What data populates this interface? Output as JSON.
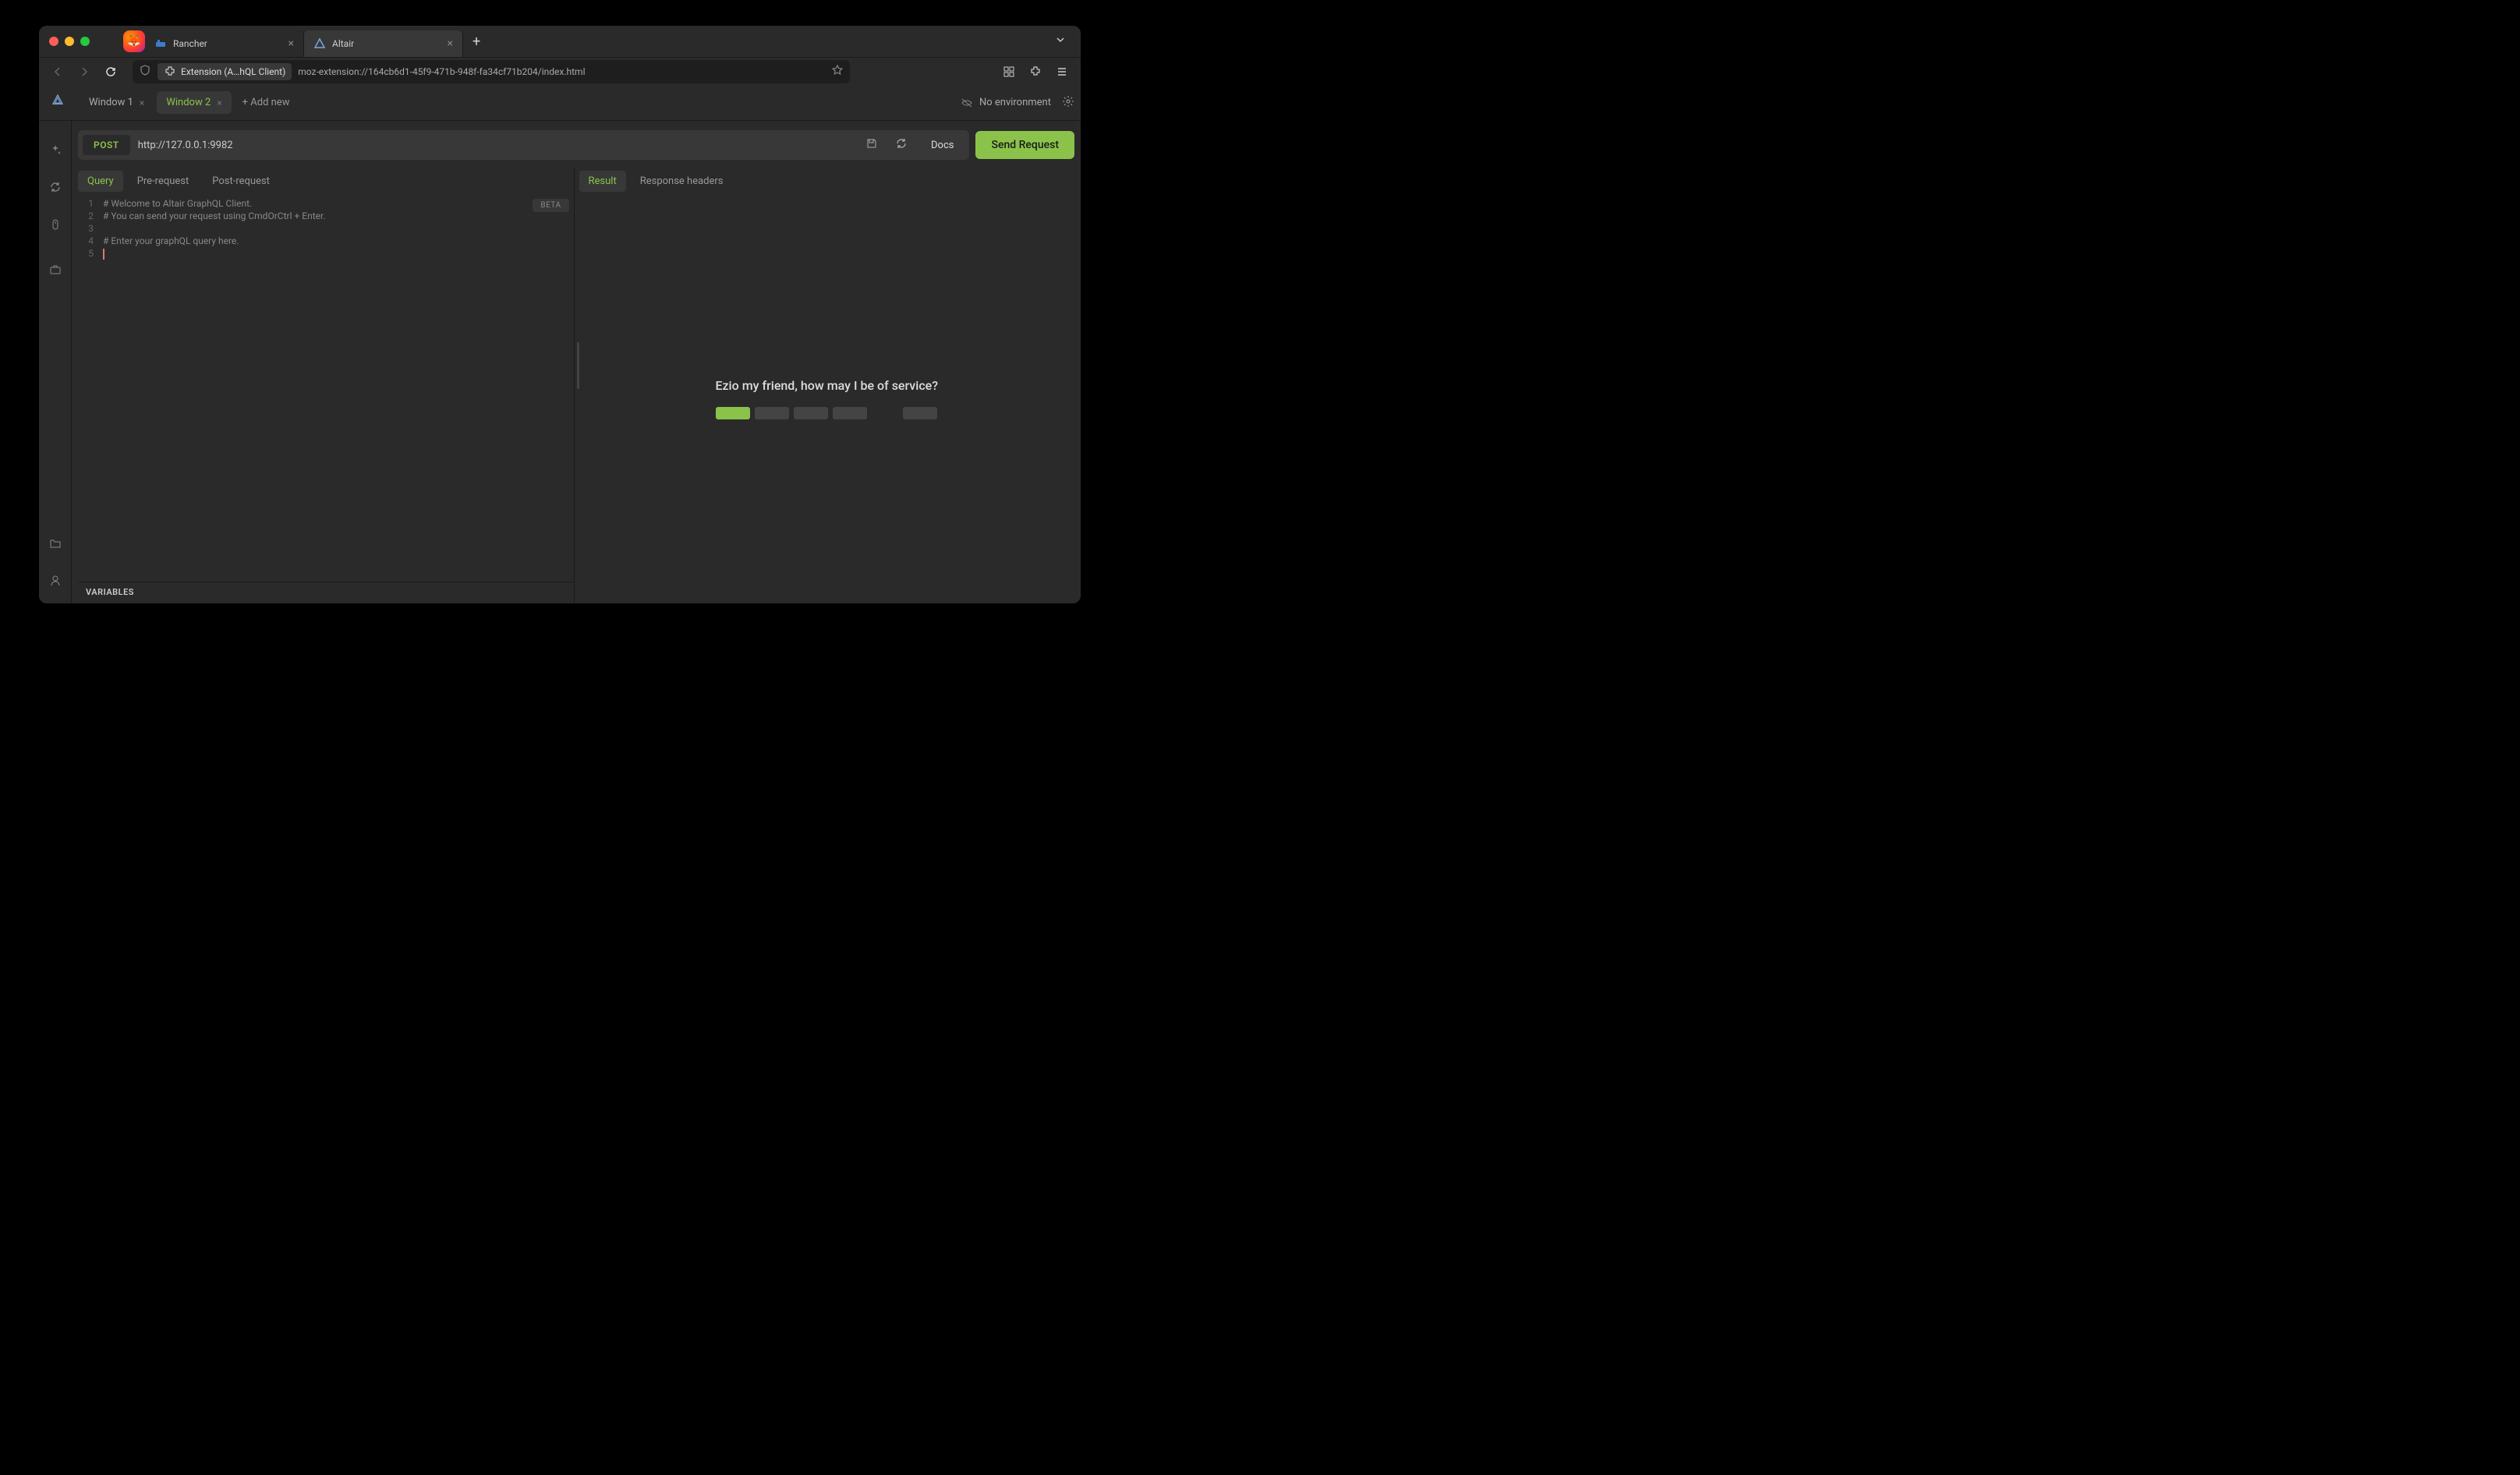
{
  "browser": {
    "tabs": [
      {
        "label": "Rancher",
        "active": false
      },
      {
        "label": "Altair",
        "active": true
      }
    ],
    "url_ext_label": "Extension (A…hQL Client)",
    "url": "moz-extension://164cb6d1-45f9-471b-948f-fa34cf71b204/index.html"
  },
  "app": {
    "windows": [
      {
        "label": "Window 1",
        "active": false
      },
      {
        "label": "Window 2",
        "active": true
      }
    ],
    "add_new_label": "+ Add new",
    "env_label": "No environment"
  },
  "request": {
    "method": "POST",
    "endpoint": "http://127.0.0.1:9982",
    "docs_label": "Docs",
    "send_label": "Send Request"
  },
  "editor": {
    "tabs": [
      "Query",
      "Pre-request",
      "Post-request"
    ],
    "active_tab": 0,
    "beta_label": "BETA",
    "lines": [
      "# Welcome to Altair GraphQL Client.",
      "# You can send your request using CmdOrCtrl + Enter.",
      "",
      "# Enter your graphQL query here.",
      ""
    ],
    "variables_label": "VARIABLES"
  },
  "result": {
    "tabs": [
      "Result",
      "Response headers"
    ],
    "active_tab": 0,
    "placeholder_message": "Ezio my friend, how may I be of service?"
  },
  "colors": {
    "accent": "#8bc34a",
    "bg": "#2a2a2a",
    "bg_raised": "#383838"
  }
}
